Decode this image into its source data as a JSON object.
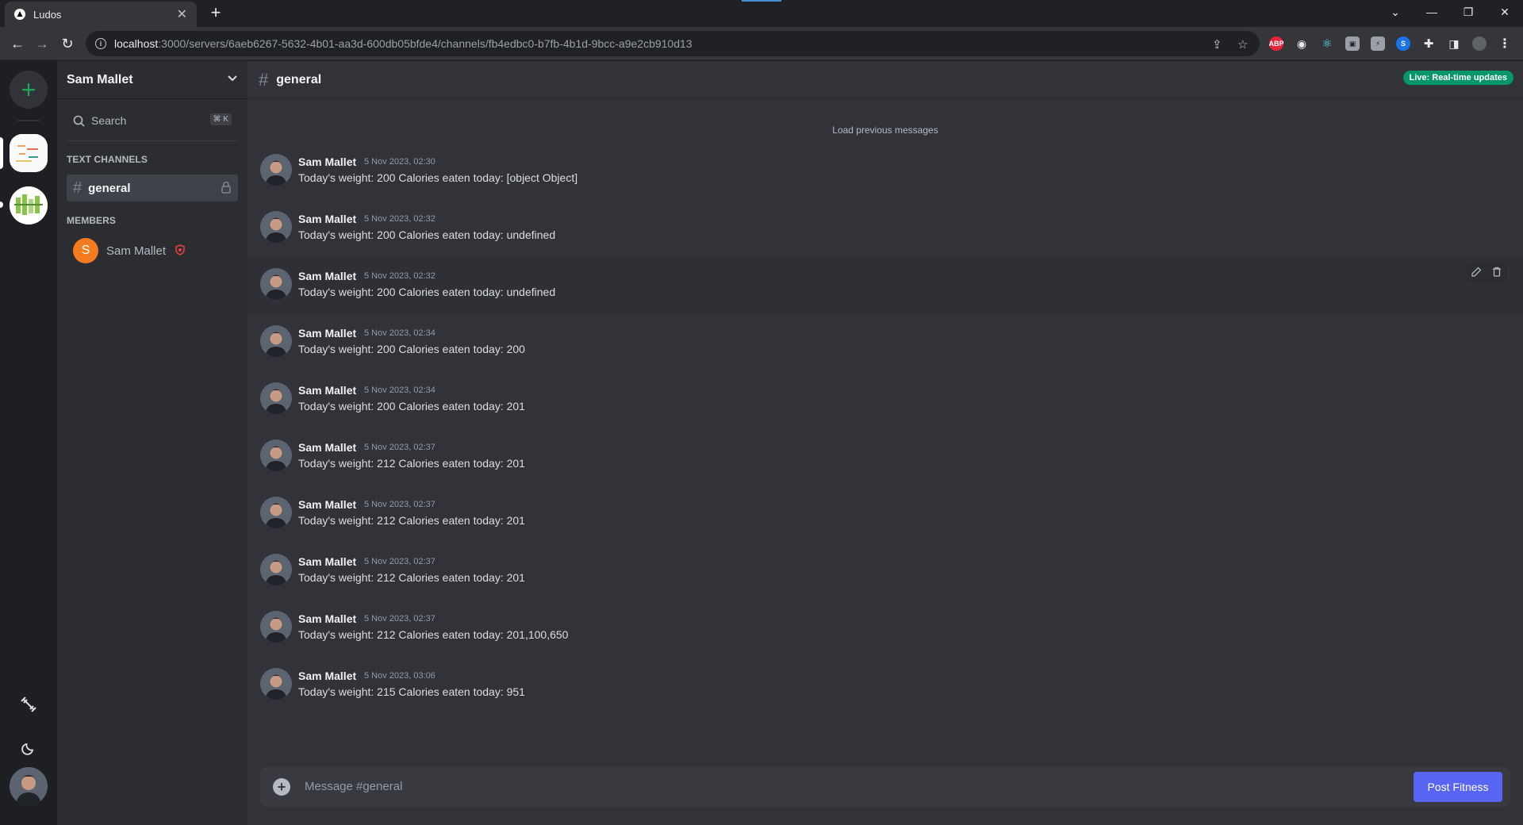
{
  "browser": {
    "tab_title": "Ludos",
    "url_host": "localhost",
    "url_path": ":3000/servers/6aeb6267-5632-4b01-aa3d-600db05bfde4/channels/fb4edbc0-b7fb-4b1d-9bcc-a9e2cb910d13",
    "extensions": [
      "ABP"
    ]
  },
  "sidebar": {
    "server_name": "Sam Mallet",
    "search_placeholder": "Search",
    "search_shortcut": "⌘ K",
    "text_channels_label": "TEXT CHANNELS",
    "channels": [
      {
        "name": "general"
      }
    ],
    "members_label": "MEMBERS",
    "members": [
      {
        "initial": "S",
        "name": "Sam Mallet"
      }
    ]
  },
  "main": {
    "channel_name": "general",
    "live_badge": "Live: Real-time updates",
    "load_previous": "Load previous messages",
    "messages": [
      {
        "author": "Sam Mallet",
        "time": "5 Nov 2023, 02:30",
        "text": "Today's weight: 200 Calories eaten today: [object Object]"
      },
      {
        "author": "Sam Mallet",
        "time": "5 Nov 2023, 02:32",
        "text": "Today's weight: 200 Calories eaten today: undefined"
      },
      {
        "author": "Sam Mallet",
        "time": "5 Nov 2023, 02:32",
        "text": "Today's weight: 200 Calories eaten today: undefined"
      },
      {
        "author": "Sam Mallet",
        "time": "5 Nov 2023, 02:34",
        "text": "Today's weight: 200 Calories eaten today: 200"
      },
      {
        "author": "Sam Mallet",
        "time": "5 Nov 2023, 02:34",
        "text": "Today's weight: 200 Calories eaten today: 201"
      },
      {
        "author": "Sam Mallet",
        "time": "5 Nov 2023, 02:37",
        "text": "Today's weight: 212 Calories eaten today: 201"
      },
      {
        "author": "Sam Mallet",
        "time": "5 Nov 2023, 02:37",
        "text": "Today's weight: 212 Calories eaten today: 201"
      },
      {
        "author": "Sam Mallet",
        "time": "5 Nov 2023, 02:37",
        "text": "Today's weight: 212 Calories eaten today: 201"
      },
      {
        "author": "Sam Mallet",
        "time": "5 Nov 2023, 02:37",
        "text": "Today's weight: 212 Calories eaten today: 201,100,650"
      },
      {
        "author": "Sam Mallet",
        "time": "5 Nov 2023, 03:06",
        "text": "Today's weight: 215 Calories eaten today: 951"
      }
    ],
    "composer_placeholder": "Message #general",
    "post_button": "Post Fitness"
  },
  "colors": {
    "accent": "#5865f2",
    "live_badge": "#059669",
    "add_server": "#23a55a",
    "member_avatar": "#f47b20",
    "admin_shield": "#f23f43"
  }
}
